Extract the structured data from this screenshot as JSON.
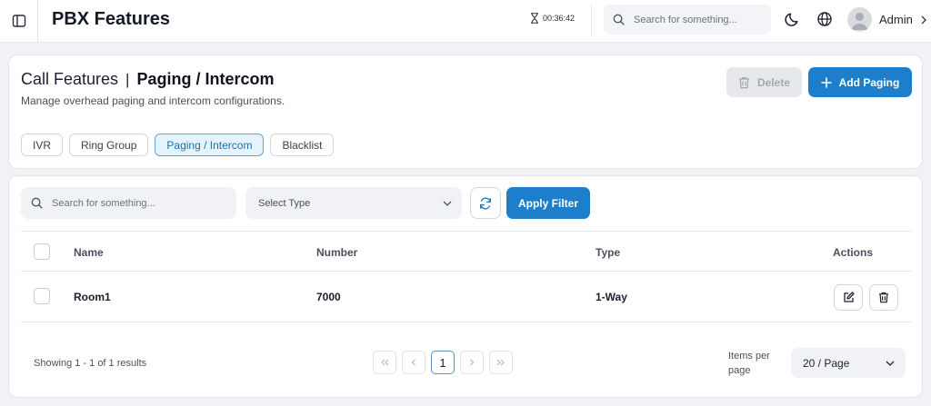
{
  "app": {
    "title": "PBX Features"
  },
  "topbar": {
    "timer": "00:36:42",
    "search_placeholder": "Search for something...",
    "user_name": "Admin"
  },
  "header": {
    "breadcrumb_parent": "Call Features",
    "breadcrumb_separator": "|",
    "breadcrumb_current": "Paging / Intercom",
    "subtitle": "Manage overhead paging and intercom configurations.",
    "delete_label": "Delete",
    "add_label": "Add Paging"
  },
  "tabs": [
    {
      "label": "IVR",
      "active": false
    },
    {
      "label": "Ring Group",
      "active": false
    },
    {
      "label": "Paging / Intercom",
      "active": true
    },
    {
      "label": "Blacklist",
      "active": false
    }
  ],
  "filters": {
    "search_placeholder": "Search for something...",
    "type_placeholder": "Select Type",
    "apply_label": "Apply Filter"
  },
  "table": {
    "columns": {
      "name": "Name",
      "number": "Number",
      "type": "Type",
      "actions": "Actions"
    },
    "rows": [
      {
        "name": "Room1",
        "number": "7000",
        "type": "1-Way"
      }
    ]
  },
  "footer": {
    "showing": "Showing 1 - 1 of 1 results",
    "current_page": "1",
    "items_per_page_label": "Items per page",
    "items_per_page_value": "20 / Page"
  },
  "colors": {
    "primary": "#1d7fcb",
    "active_tab_bg": "#e6f3fc",
    "disabled_button": "#e7e8eb"
  },
  "icons": {
    "sidebar_toggle": "sidebar-panel-icon",
    "timer": "hourglass-icon",
    "search": "search-icon",
    "theme": "moon-icon",
    "language": "globe-icon",
    "user": "user-avatar-icon",
    "expand": "chevron-right-icon",
    "delete": "trash-icon",
    "add": "plus-icon",
    "refresh": "refresh-icon",
    "edit": "edit-icon"
  }
}
